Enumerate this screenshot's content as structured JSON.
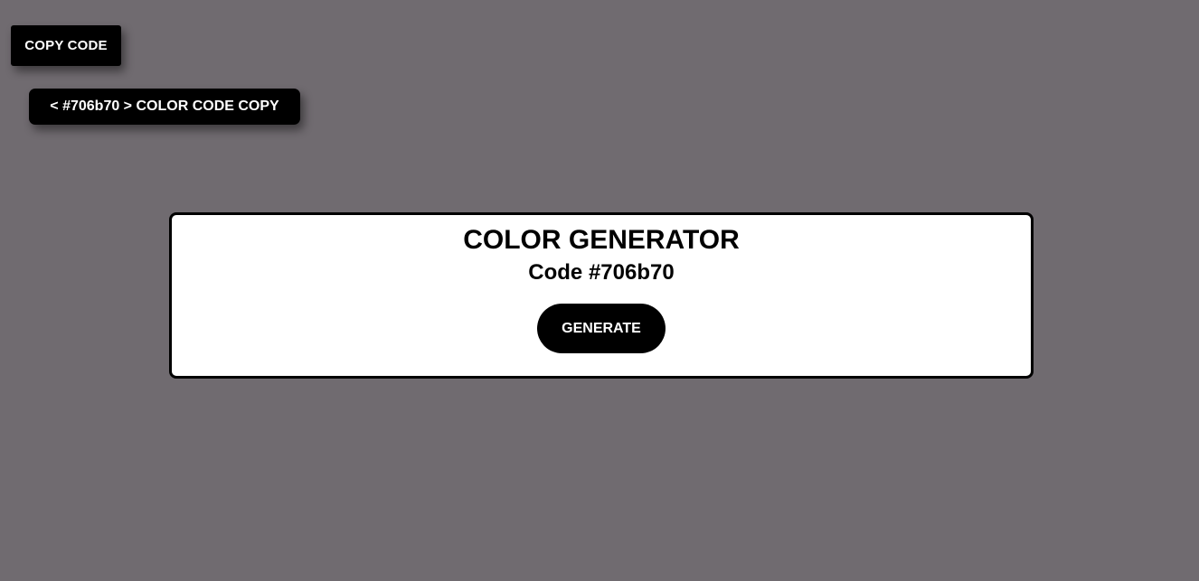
{
  "copy_button": {
    "label": "COPY CODE"
  },
  "copy_toast": {
    "text": "< #706b70 > COLOR CODE COPY"
  },
  "card": {
    "title": "COLOR GENERATOR",
    "code_text": "Code #706b70",
    "generate_label": "GENERATE"
  },
  "colors": {
    "background": "#706b70",
    "card_background": "#ffffff",
    "button_background": "#000000",
    "button_text": "#ffffff"
  }
}
